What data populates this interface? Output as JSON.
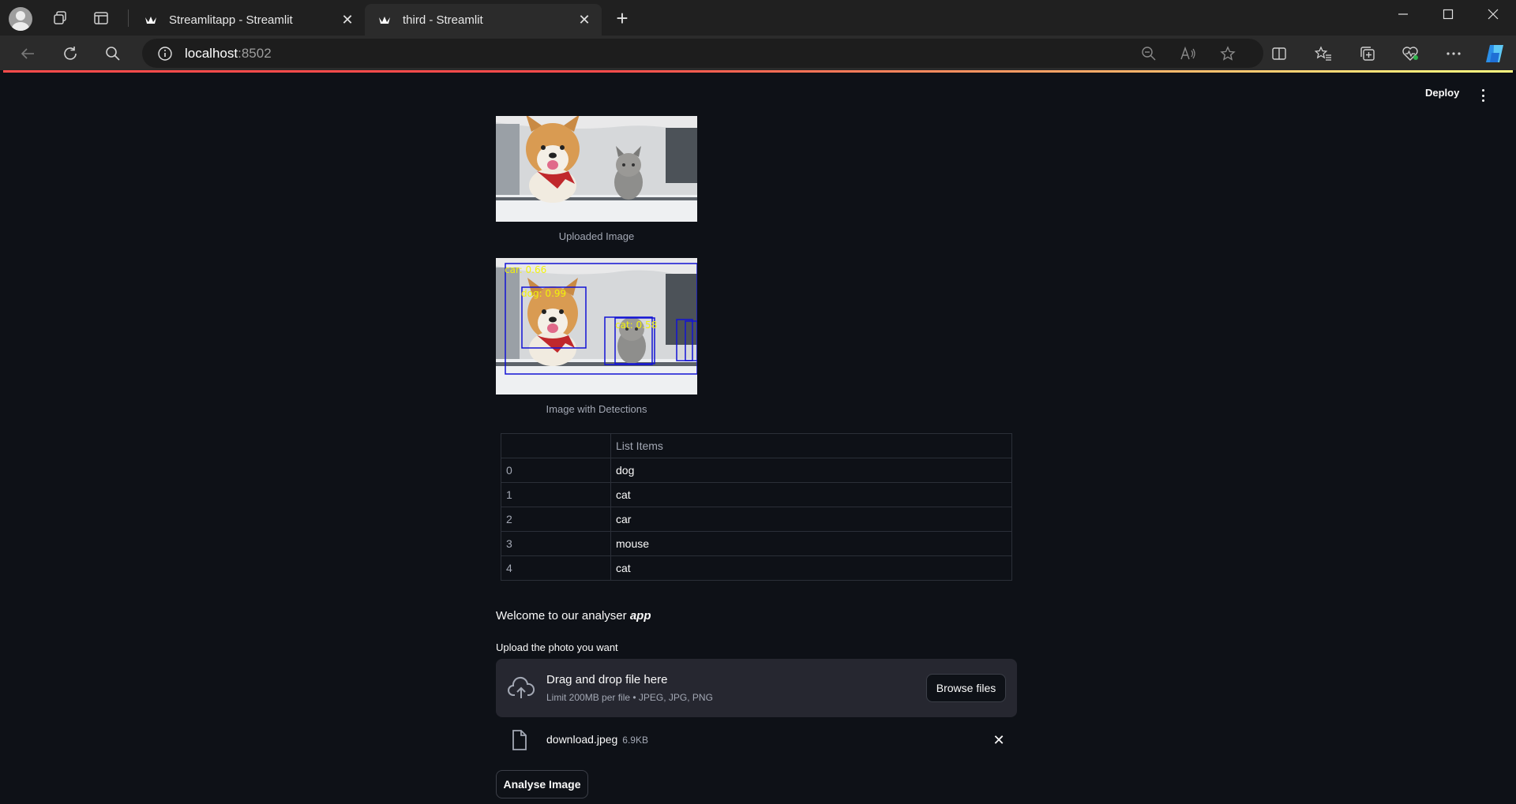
{
  "browser": {
    "tabs": [
      {
        "title": "Streamlitapp - Streamlit",
        "active": false
      },
      {
        "title": "third - Streamlit",
        "active": true
      }
    ],
    "url_host": "localhost",
    "url_port": ":8502"
  },
  "header": {
    "deploy_label": "Deploy"
  },
  "images": {
    "uploaded_caption": "Uploaded Image",
    "detections_caption": "Image with Detections",
    "detections": [
      {
        "label": "car: 0.66"
      },
      {
        "label": "dog: 0.99"
      },
      {
        "label": "cat: 0.58"
      }
    ]
  },
  "table": {
    "column_header": "List Items",
    "rows": [
      {
        "index": "0",
        "value": "dog"
      },
      {
        "index": "1",
        "value": "cat"
      },
      {
        "index": "2",
        "value": "car"
      },
      {
        "index": "3",
        "value": "mouse"
      },
      {
        "index": "4",
        "value": "cat"
      }
    ]
  },
  "welcome": {
    "text_before": "Welcome to our analyser ",
    "text_emph": "app"
  },
  "uploader": {
    "label": "Upload the photo you want",
    "drop_title": "Drag and drop file here",
    "drop_subtitle": "Limit 200MB per file • JPEG, JPG, PNG",
    "browse_label": "Browse files",
    "file_name": "download.jpeg",
    "file_size": "6.9KB"
  },
  "analyse_button": "Analyse Image",
  "colors": {
    "background": "#0e1117",
    "accent": "#ff4b4b",
    "detection_box": "#1010d0",
    "detection_text": "#ffff00"
  }
}
